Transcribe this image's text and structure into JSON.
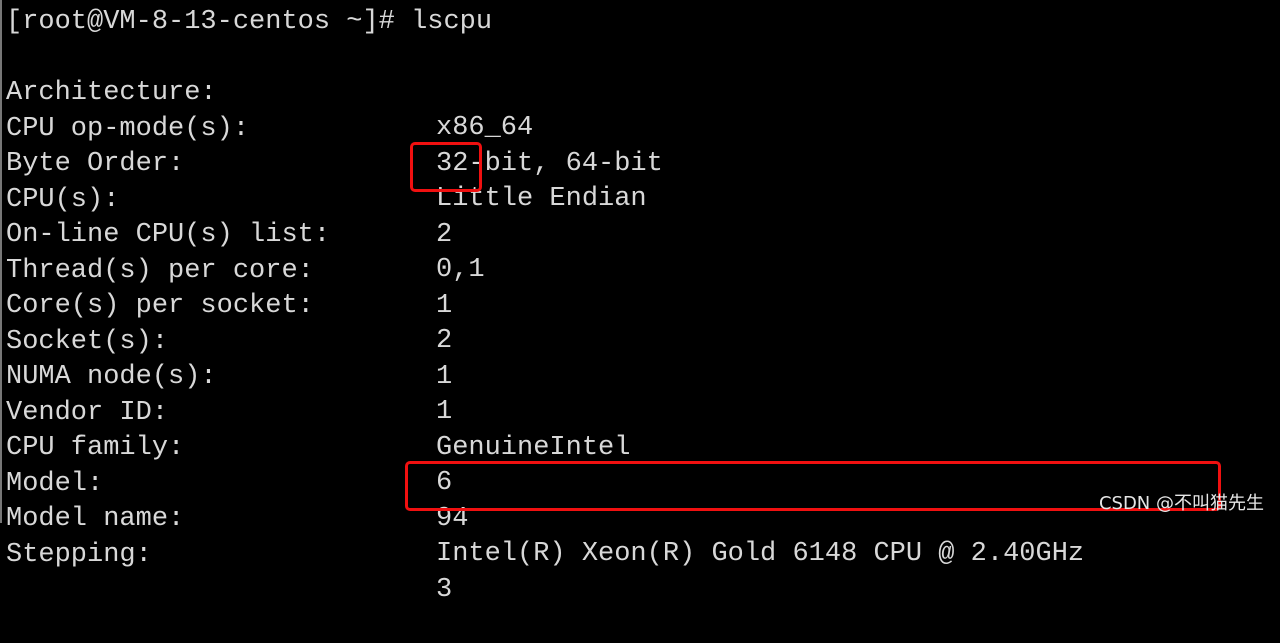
{
  "prompt": "[root@VM-8-13-centos ~]# lscpu",
  "rows": [
    {
      "label": "Architecture:",
      "value": "x86_64"
    },
    {
      "label": "CPU op-mode(s):",
      "value": "32-bit, 64-bit"
    },
    {
      "label": "Byte Order:",
      "value": "Little Endian"
    },
    {
      "label": "CPU(s):",
      "value": "2"
    },
    {
      "label": "On-line CPU(s) list:",
      "value": "0,1"
    },
    {
      "label": "Thread(s) per core:",
      "value": "1"
    },
    {
      "label": "Core(s) per socket:",
      "value": "2"
    },
    {
      "label": "Socket(s):",
      "value": "1"
    },
    {
      "label": "NUMA node(s):",
      "value": "1"
    },
    {
      "label": "Vendor ID:",
      "value": "GenuineIntel"
    },
    {
      "label": "CPU family:",
      "value": "6"
    },
    {
      "label": "Model:",
      "value": "94"
    },
    {
      "label": "Model name:",
      "value": "Intel(R) Xeon(R) Gold 6148 CPU @ 2.40GHz"
    },
    {
      "label": "Stepping:",
      "value": "3"
    }
  ],
  "highlight_color": "#f01010",
  "watermark": "CSDN @不叫猫先生"
}
